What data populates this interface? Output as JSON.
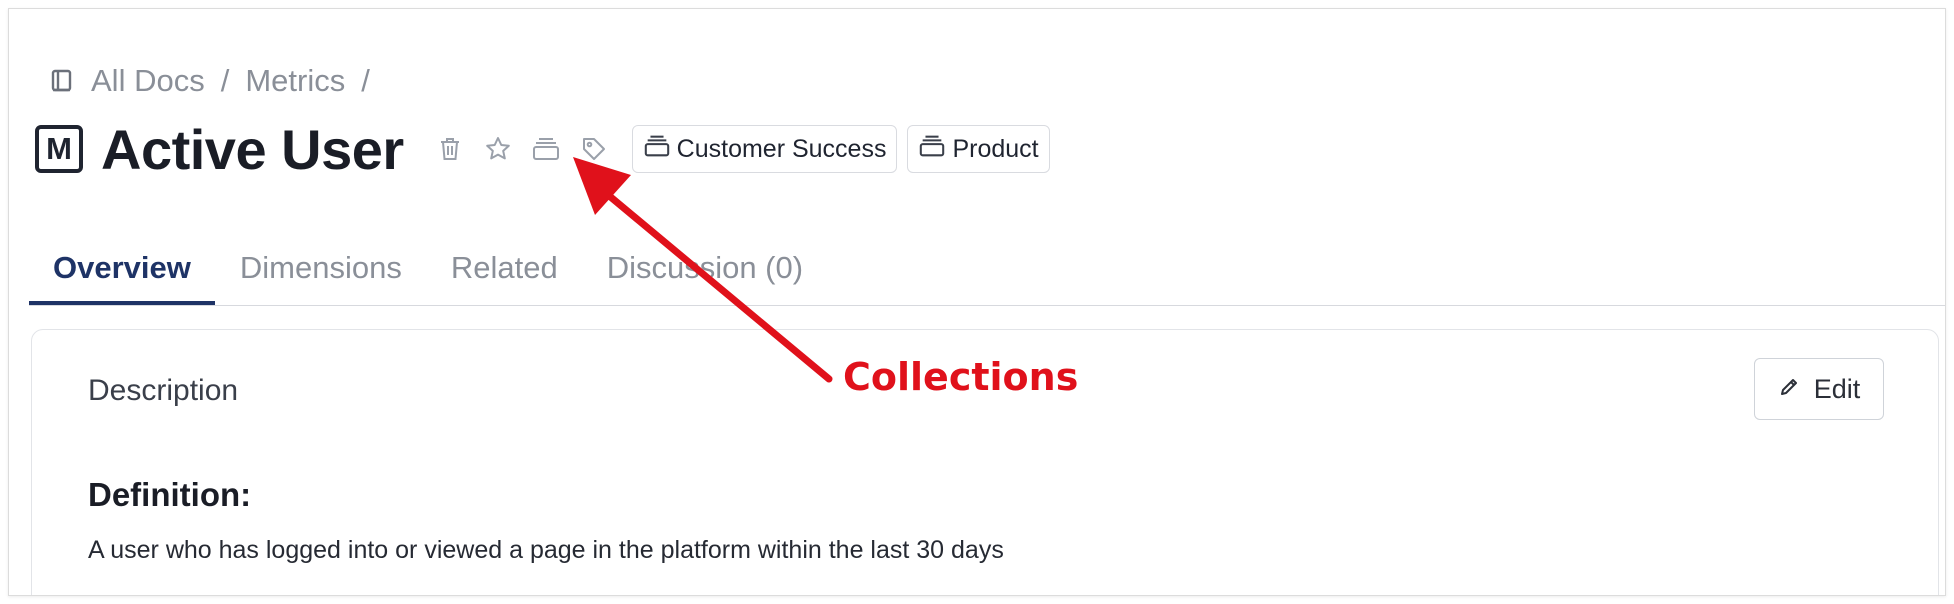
{
  "breadcrumb": {
    "items": [
      "All Docs",
      "/",
      "Metrics",
      "/"
    ]
  },
  "page": {
    "type_badge": "M",
    "title": "Active User"
  },
  "collections": [
    {
      "label": "Customer Success"
    },
    {
      "label": "Product"
    }
  ],
  "tabs": [
    {
      "label": "Overview"
    },
    {
      "label": "Dimensions"
    },
    {
      "label": "Related"
    },
    {
      "label": "Discussion (0)"
    }
  ],
  "description": {
    "heading": "Description",
    "edit_label": "Edit",
    "definition_title": "Definition:",
    "definition_text": "A user who has logged into or viewed a page in the platform within the last 30 days"
  },
  "annotation": {
    "label": "Collections",
    "color": "#e0111b"
  },
  "colors": {
    "active_tab": "#1e3366",
    "muted_text": "#8a8f98"
  }
}
